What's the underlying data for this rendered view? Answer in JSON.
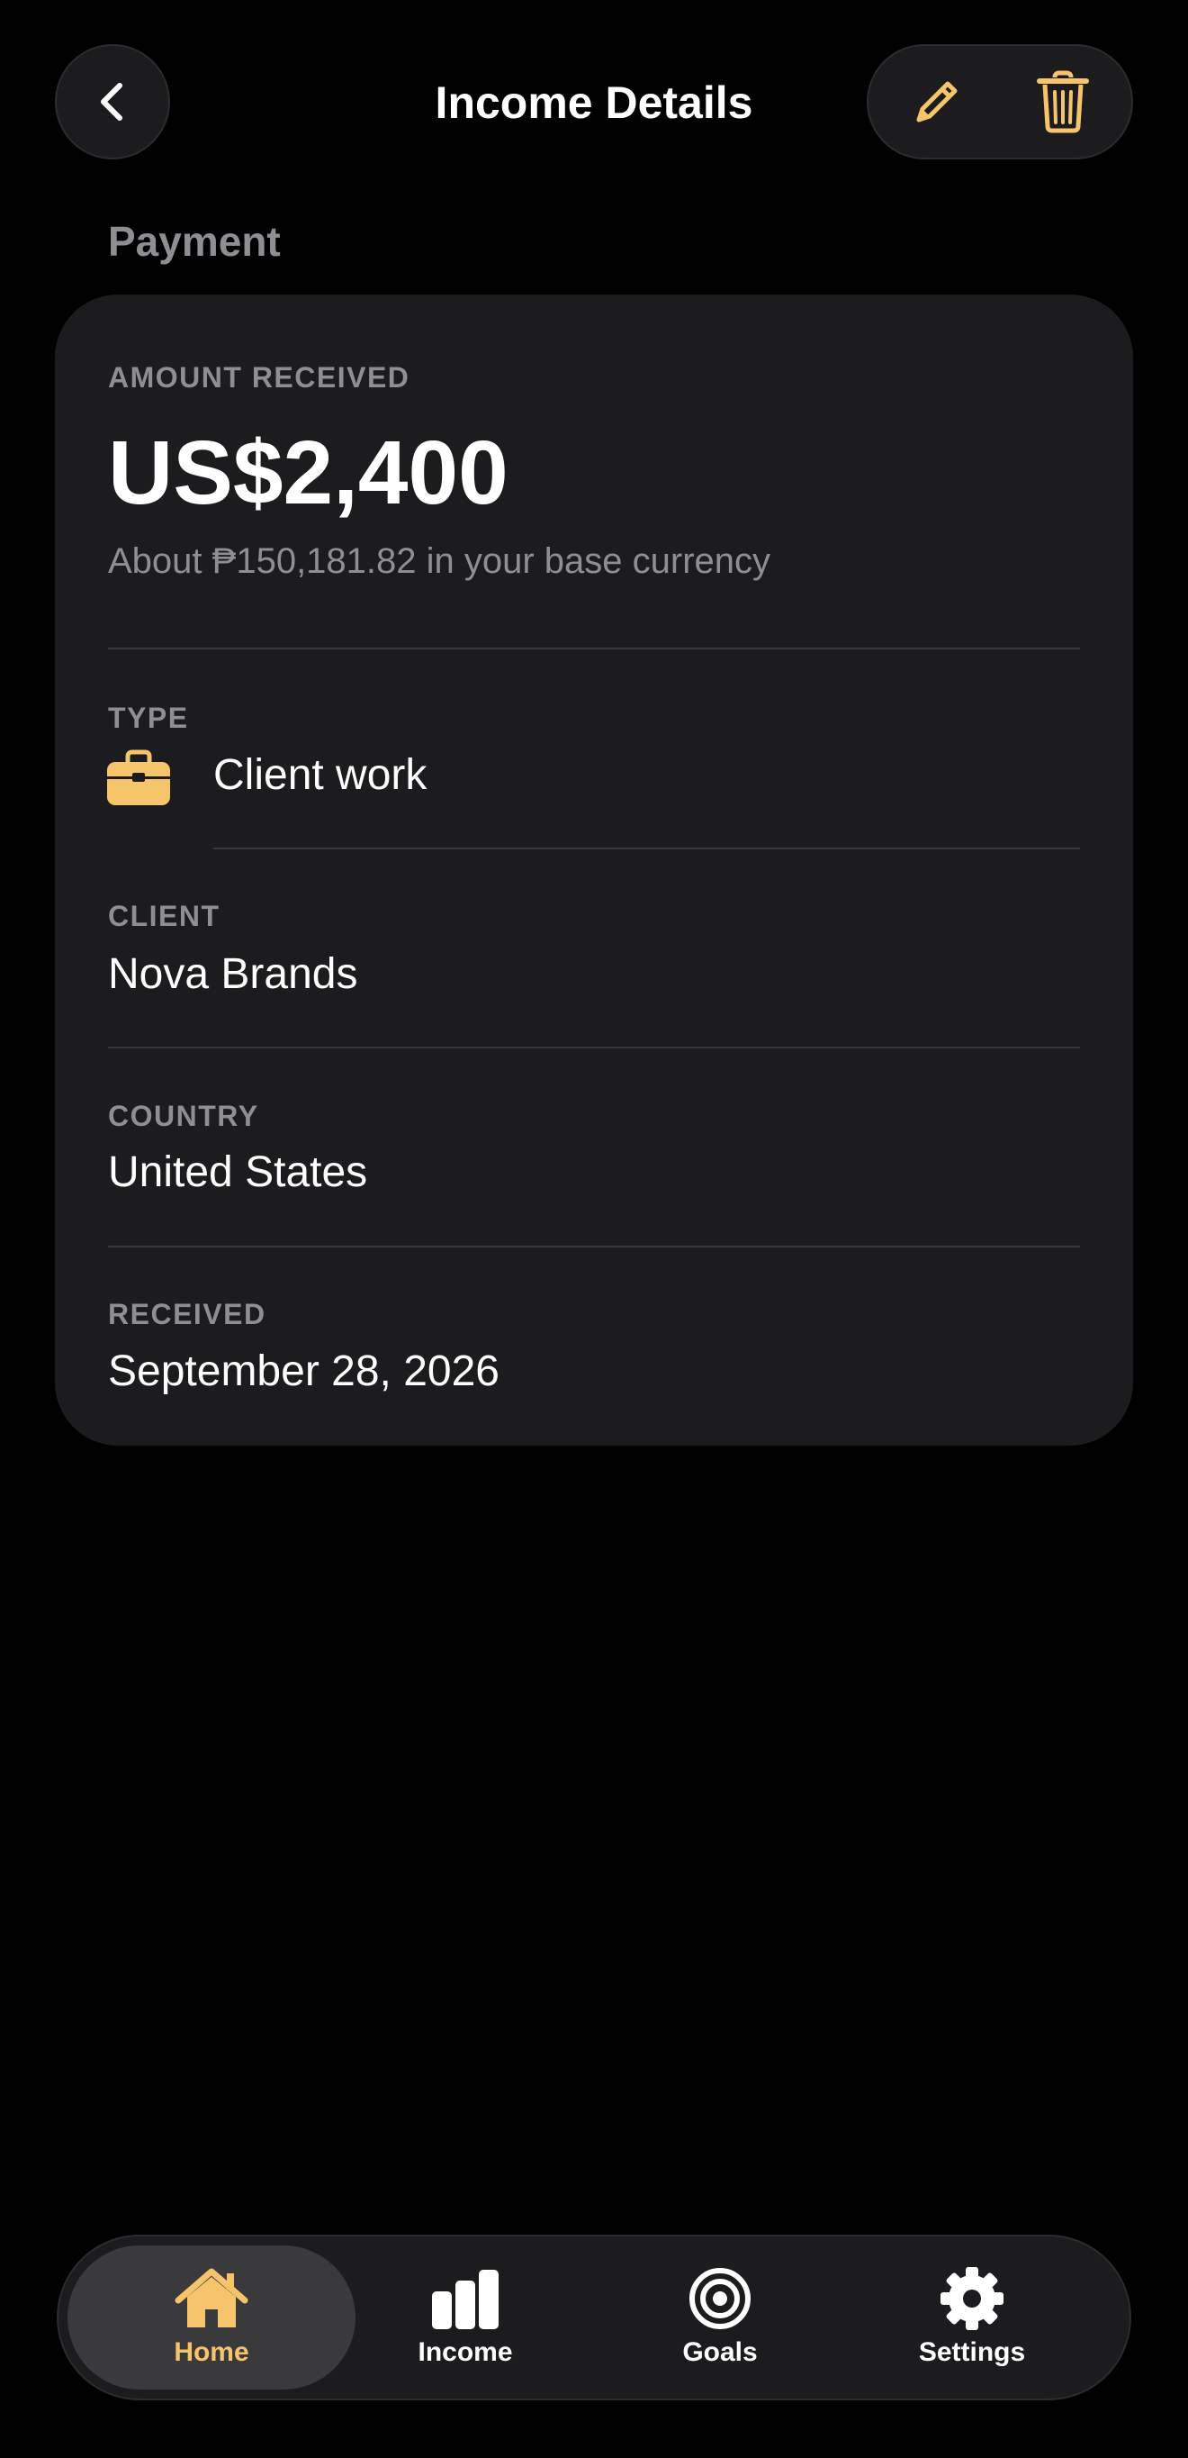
{
  "header": {
    "title": "Income Details",
    "back_icon": "chevron-left-icon",
    "edit_icon": "pencil-icon",
    "delete_icon": "trash-icon"
  },
  "section": {
    "label": "Payment"
  },
  "card": {
    "amount_label": "AMOUNT RECEIVED",
    "amount": "US$2,400",
    "amount_base": "About ₱150,181.82 in your base currency",
    "type_label": "TYPE",
    "type_value": "Client work",
    "type_icon": "briefcase-icon",
    "client_label": "CLIENT",
    "client_value": "Nova Brands",
    "country_label": "COUNTRY",
    "country_value": "United States",
    "received_label": "RECEIVED",
    "received_value": "September 28, 2026"
  },
  "tabs": [
    {
      "label": "Home",
      "icon": "home-icon",
      "active": true
    },
    {
      "label": "Income",
      "icon": "bar-chart-icon",
      "active": false
    },
    {
      "label": "Goals",
      "icon": "target-icon",
      "active": false
    },
    {
      "label": "Settings",
      "icon": "gear-icon",
      "active": false
    }
  ],
  "colors": {
    "accent": "#f6c56b",
    "background": "#000000",
    "card": "#1c1c1e",
    "secondary_text": "#8e8e93",
    "divider": "#38383a"
  }
}
